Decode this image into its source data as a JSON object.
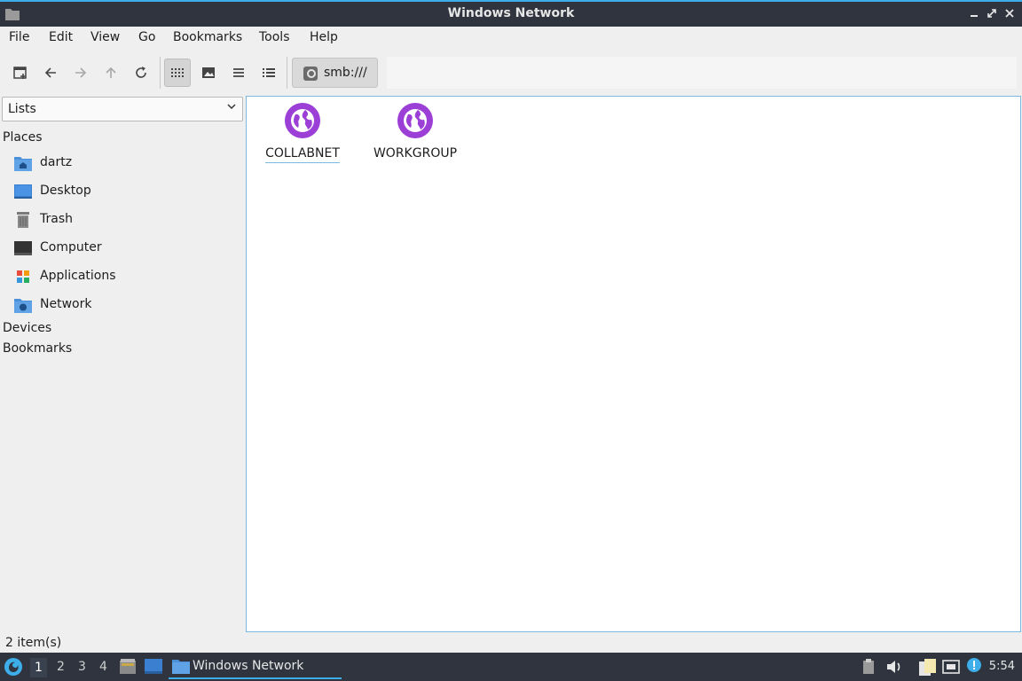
{
  "window": {
    "title": "Windows Network",
    "buttons": [
      "minimize",
      "maximize",
      "close"
    ]
  },
  "menu": [
    "File",
    "Edit",
    "View",
    "Go",
    "Bookmarks",
    "Tools",
    "Help"
  ],
  "toolbar": {
    "buttons": [
      "new-tab-icon",
      "back-icon",
      "forward-icon",
      "up-icon",
      "reload-icon",
      "icon-view-icon",
      "thumbnail-view-icon",
      "compact-view-icon",
      "detail-view-icon"
    ],
    "active_view": "icon-view"
  },
  "location": {
    "path": "smb:///"
  },
  "sidebar": {
    "mode": "Lists",
    "sections": {
      "places": "Places",
      "devices": "Devices",
      "bookmarks": "Bookmarks"
    },
    "places": [
      {
        "label": "dartz",
        "icon": "home-folder-icon"
      },
      {
        "label": "Desktop",
        "icon": "desktop-icon"
      },
      {
        "label": "Trash",
        "icon": "trash-icon"
      },
      {
        "label": "Computer",
        "icon": "computer-icon"
      },
      {
        "label": "Applications",
        "icon": "applications-icon"
      },
      {
        "label": "Network",
        "icon": "network-folder-icon"
      }
    ]
  },
  "items": [
    {
      "label": "COLLABNET",
      "icon": "network-workgroup-icon",
      "focused": true
    },
    {
      "label": "WORKGROUP",
      "icon": "network-workgroup-icon",
      "focused": false
    }
  ],
  "status": {
    "text": "2 item(s)"
  },
  "taskbar": {
    "workspaces": [
      "1",
      "2",
      "3",
      "4"
    ],
    "active_workspace": "1",
    "task_label": "Windows Network",
    "clock": "5:54"
  },
  "colors": {
    "titlebar": "#2f343f",
    "accent": "#3daee9",
    "network_icon": "#9b3fd6"
  }
}
